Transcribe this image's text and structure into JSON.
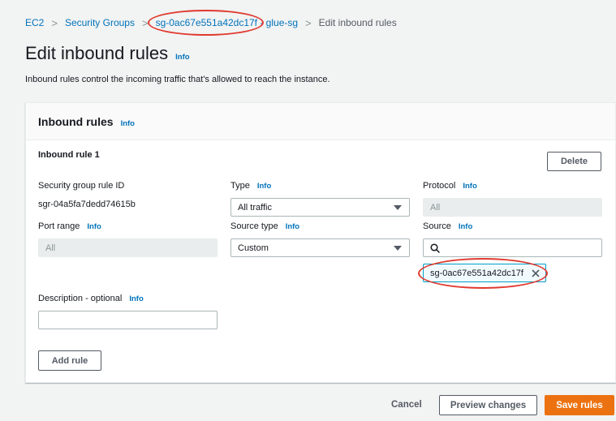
{
  "breadcrumb": {
    "ec2": "EC2",
    "security_groups": "Security Groups",
    "sg_id": "sg-0ac67e551a42dc17f",
    "sg_name_suffix": " - glue-sg",
    "current": "Edit inbound rules"
  },
  "page": {
    "title": "Edit inbound rules",
    "info": "Info",
    "description": "Inbound rules control the incoming traffic that's allowed to reach the instance."
  },
  "panel": {
    "title": "Inbound rules",
    "info": "Info"
  },
  "rule": {
    "heading": "Inbound rule 1",
    "delete_label": "Delete",
    "rule_id_label": "Security group rule ID",
    "rule_id_value": "sgr-04a5fa7dedd74615b",
    "type_label": "Type",
    "type_value": "All traffic",
    "protocol_label": "Protocol",
    "protocol_value": "All",
    "port_range_label": "Port range",
    "port_range_value": "All",
    "source_type_label": "Source type",
    "source_type_value": "Custom",
    "source_label": "Source",
    "source_search_value": "",
    "source_token": "sg-0ac67e551a42dc17f",
    "description_label": "Description - optional",
    "description_value": ""
  },
  "add_rule_label": "Add rule",
  "footer": {
    "cancel": "Cancel",
    "preview": "Preview changes",
    "save": "Save rules"
  },
  "icons": {
    "separator": "chevron-right-icon",
    "dropdown": "caret-down-icon",
    "search": "search-icon",
    "remove": "close-icon"
  },
  "colors": {
    "link": "#0073bb",
    "primary": "#ec7211",
    "annotation": "#e03a2f"
  }
}
